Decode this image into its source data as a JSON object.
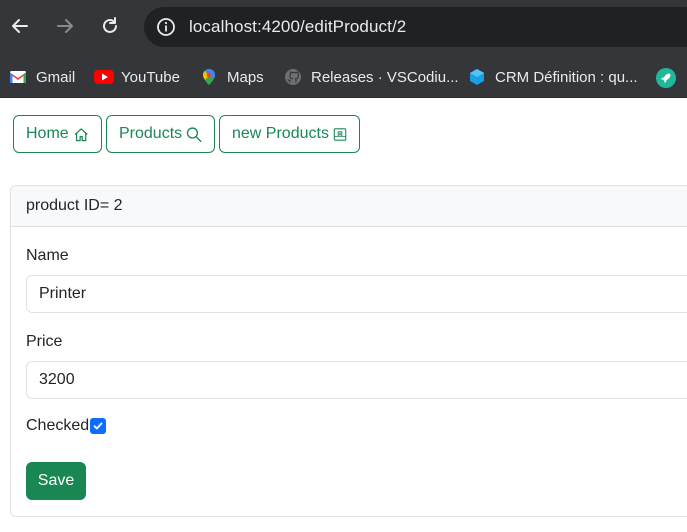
{
  "browser": {
    "url": "localhost:4200/editProduct/2",
    "bookmarks": [
      {
        "label": "Gmail"
      },
      {
        "label": "YouTube"
      },
      {
        "label": "Maps"
      },
      {
        "label": "Releases · VSCodiu..."
      },
      {
        "label": "CRM Définition : qu..."
      }
    ]
  },
  "nav": {
    "home_label": "Home",
    "products_label": "Products",
    "new_products_label": "new Products"
  },
  "form": {
    "header": "product ID= 2",
    "name_label": "Name",
    "name_value": "Printer",
    "price_label": "Price",
    "price_value": "3200",
    "checked_label": "Checked",
    "checked": true,
    "save_label": "Save"
  },
  "colors": {
    "browser_bg": "#35363a",
    "omnibox_bg": "#202124",
    "success": "#198754",
    "primary": "#0d6efd"
  }
}
